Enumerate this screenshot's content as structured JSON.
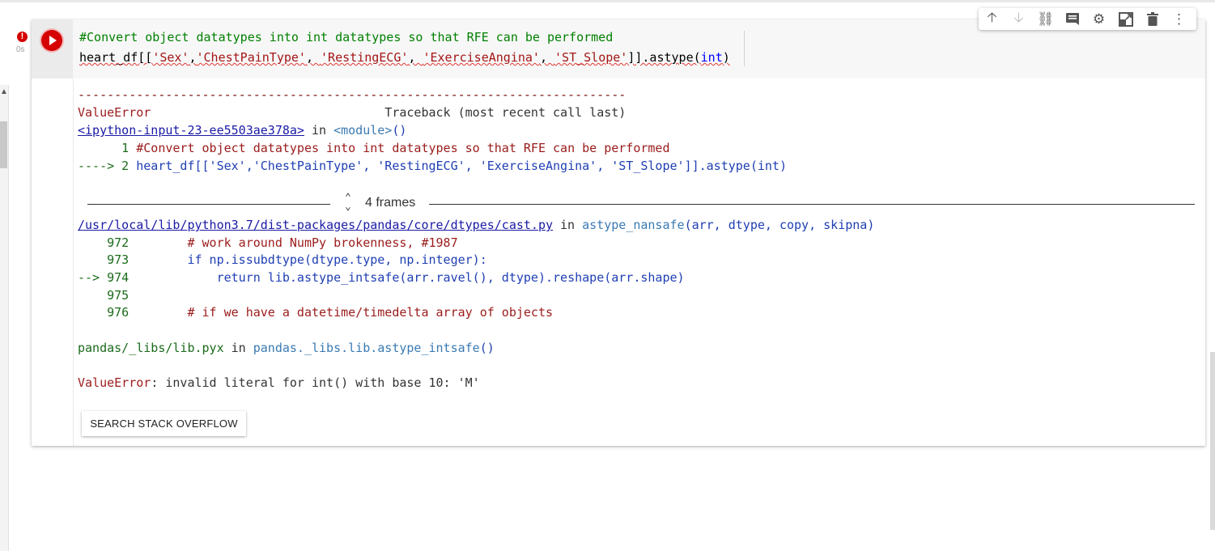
{
  "cell": {
    "exec_time": "0s",
    "error_badge": "!",
    "code_line1": "#Convert object datatypes into int datatypes so that RFE can be performed",
    "code_line2": {
      "a": "heart_df[[",
      "s1": "'Sex'",
      "c1": ",",
      "s2": "'ChestPainType'",
      "c2": ", ",
      "s3": "'RestingECG'",
      "c3": ", ",
      "s4": "'ExerciseAngina'",
      "c4": ", ",
      "s5": "'ST_Slope'",
      "b": "]].astype(",
      "kw": "int",
      "end": ")"
    }
  },
  "toolbar": {
    "icons": [
      "arrow-up-icon",
      "arrow-down-icon",
      "link-icon",
      "comment-icon",
      "gear-icon",
      "mirror-cell-icon",
      "trash-icon",
      "more-vert-icon"
    ]
  },
  "traceback": {
    "dashes": "---------------------------------------------------------------------------",
    "error_type": "ValueError",
    "header_pad": "                                ",
    "header_right": "Traceback (most recent call last)",
    "input_link": "<ipython-input-23-ee5503ae378a>",
    "in_word": " in ",
    "module": "<module>",
    "parens": "()",
    "ctx_line1_num": "      1 ",
    "ctx_line1_text": "#Convert object datatypes into int datatypes so that RFE can be performed",
    "ctx_line2_arrow": "----> 2 ",
    "ctx_line2_text": "heart_df[['Sex','ChestPainType', 'RestingECG', 'ExerciseAngina', 'ST_Slope']].astype(int)",
    "frames_label": "4 frames",
    "file_link": "/usr/local/lib/python3.7/dist-packages/pandas/core/dtypes/cast.py",
    "func_name": "astype_nansafe",
    "func_args": "(arr, dtype, copy, skipna)",
    "l972_num": "    972 ",
    "l972_text": "       # work around NumPy brokenness, #1987",
    "l973_num": "    973 ",
    "l973_text": "       if np.issubdtype(dtype.type, np.integer):",
    "l974_arrow": "--> 974 ",
    "l974_text": "           return lib.astype_intsafe(arr.ravel(), dtype).reshape(arr.shape)",
    "l975_num": "    975 ",
    "l976_num": "    976 ",
    "l976_text": "       # if we have a datetime/timedelta array of objects",
    "pyx_file": "pandas/_libs/lib.pyx",
    "pyx_func": "pandas._libs.lib.astype_intsafe",
    "pyx_parens": "()",
    "final_type": "ValueError",
    "final_msg": ": invalid literal for int() with base 10: 'M'"
  },
  "buttons": {
    "search_so": "SEARCH STACK OVERFLOW"
  }
}
